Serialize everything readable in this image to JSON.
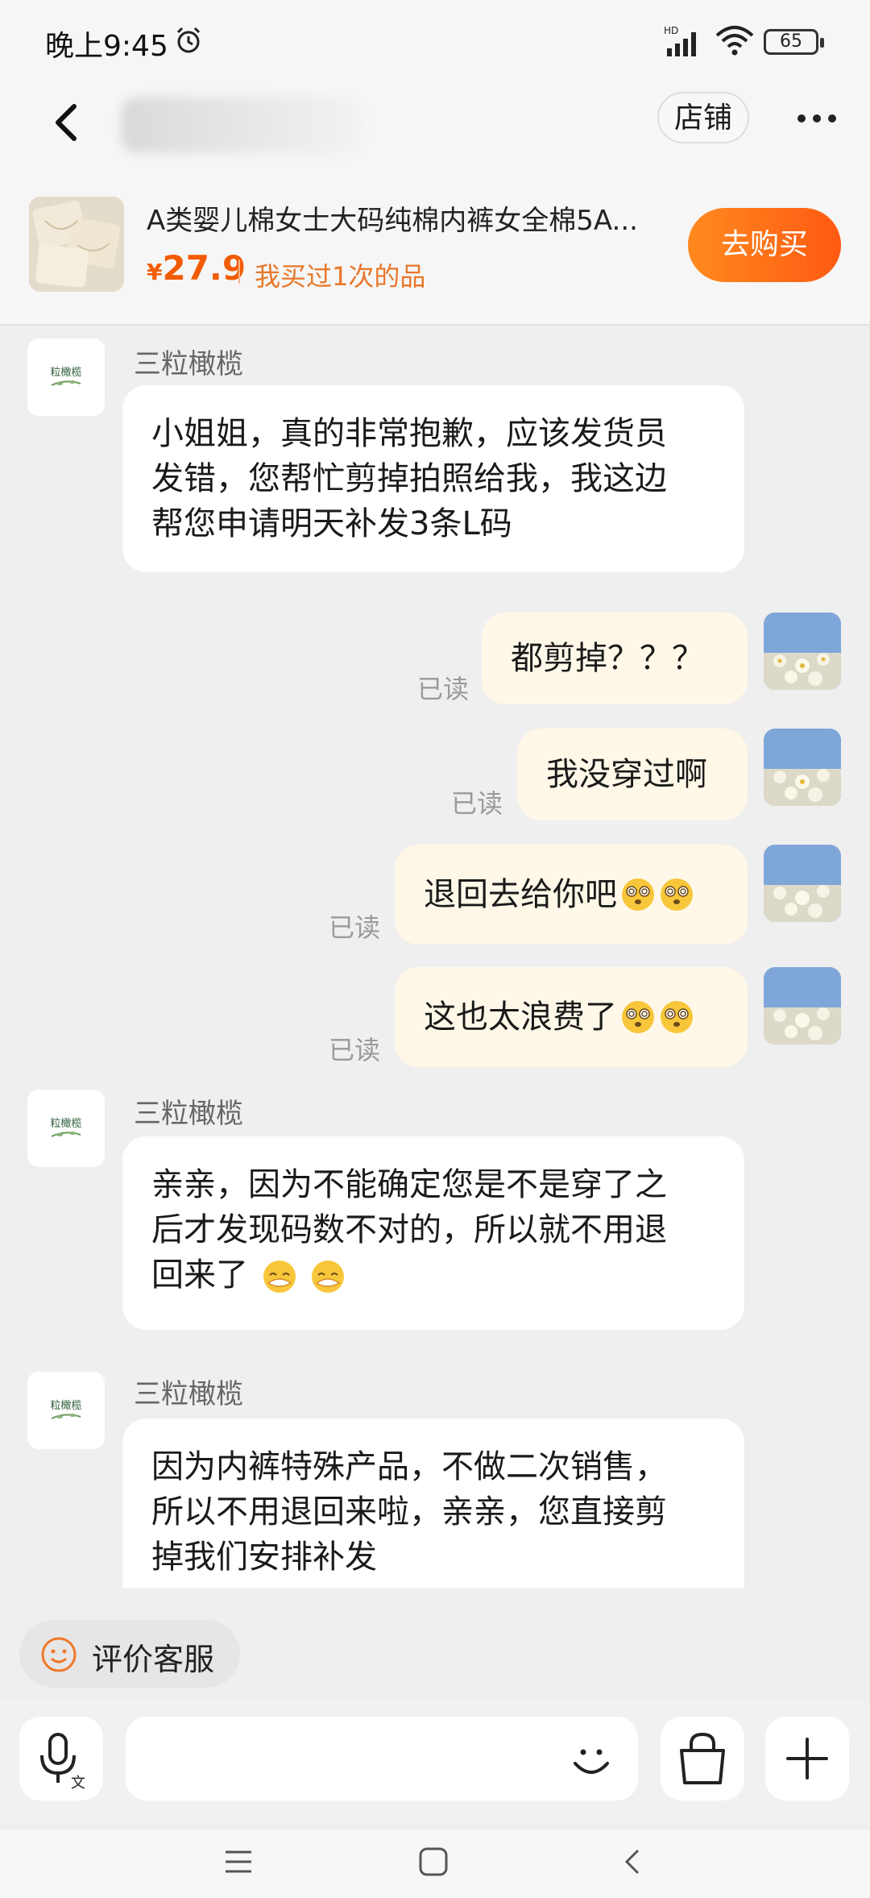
{
  "status_bar": {
    "time": "晚上9:45",
    "battery": "65",
    "network_label": "HD"
  },
  "header": {
    "store_button": "店铺",
    "blurred_subtitle": "铁"
  },
  "product": {
    "title": "A类婴儿棉女士大码纯棉内裤女全棉5A...",
    "currency": "¥",
    "price": "27.9",
    "bought_tag": "我买过1次的品",
    "buy_button": "去购买"
  },
  "messages": {
    "shop_name": "三粒橄榄",
    "shop_avatar_text": "粒橄榄",
    "read_label": "已读",
    "m1": [
      "小姐姐，真的非常抱歉，应该发货员",
      "发错，您帮忙剪掉拍照给我，我这边",
      "帮您申请明天补发3条L码"
    ],
    "m2": "都剪掉？？？",
    "m3": "我没穿过啊",
    "m4": "退回去给你吧",
    "m5": "这也太浪费了",
    "m6": [
      "亲亲，因为不能确定您是不是穿了之",
      "后才发现码数不对的，所以就不用退",
      "回来了"
    ],
    "m7": [
      "因为内裤特殊产品，不做二次销售，",
      "所以不用退回来啦，亲亲，您直接剪",
      "掉我们安排补发"
    ]
  },
  "bottom": {
    "rate_label": "评价客服",
    "input_placeholder": ""
  },
  "icons": [
    "back-icon",
    "more-icon",
    "alarm-icon",
    "wifi-icon",
    "dizzy-face-icon",
    "smirk-face-icon",
    "smile-icon",
    "microphone-icon",
    "shopping-bag-icon",
    "plus-icon",
    "menu-icon",
    "home-icon",
    "nav-back-icon"
  ],
  "colors": {
    "accent": "#ff6a14",
    "price": "#f25c05",
    "user_bubble": "#fff8e8"
  }
}
